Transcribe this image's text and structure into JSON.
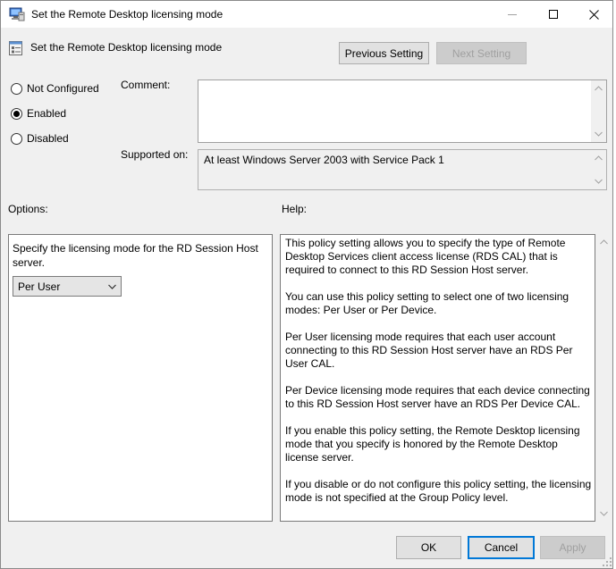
{
  "window": {
    "title": "Set the Remote Desktop licensing mode",
    "controls": [
      "minimize-icon",
      "maximize-icon",
      "close-icon"
    ]
  },
  "header": {
    "policy_title": "Set the Remote Desktop licensing mode",
    "prev_label": "Previous Setting",
    "next_label": "Next Setting"
  },
  "state": {
    "options": [
      {
        "label": "Not Configured",
        "checked": false
      },
      {
        "label": "Enabled",
        "checked": true
      },
      {
        "label": "Disabled",
        "checked": false
      }
    ]
  },
  "comment": {
    "label": "Comment:",
    "value": ""
  },
  "supported": {
    "label": "Supported on:",
    "value": "At least Windows Server 2003 with Service Pack 1"
  },
  "options_section": {
    "label": "Options:",
    "description": "Specify the licensing mode for the RD Session Host server.",
    "selected": "Per User"
  },
  "help_section": {
    "label": "Help:",
    "paragraphs": [
      "This policy setting allows you to specify the type of Remote Desktop Services client access license (RDS CAL) that is required to connect to this RD Session Host server.",
      "You can use this policy setting to select one of two licensing modes: Per User or Per Device.",
      "Per User licensing mode requires that each user account connecting to this RD Session Host server have an RDS Per User CAL.",
      "Per Device licensing mode requires that each device connecting to this RD Session Host server have an RDS Per Device CAL.",
      "If you enable this policy setting, the Remote Desktop licensing mode that you specify is honored by the Remote Desktop license server.",
      "If you disable or do not configure this policy setting, the licensing mode is not specified at the Group Policy level."
    ]
  },
  "footer": {
    "ok_label": "OK",
    "cancel_label": "Cancel",
    "apply_label": "Apply"
  },
  "colors": {
    "accent": "#0078d7",
    "window_bg": "#f0f0f0",
    "disabled_text": "#a0a0a0"
  }
}
